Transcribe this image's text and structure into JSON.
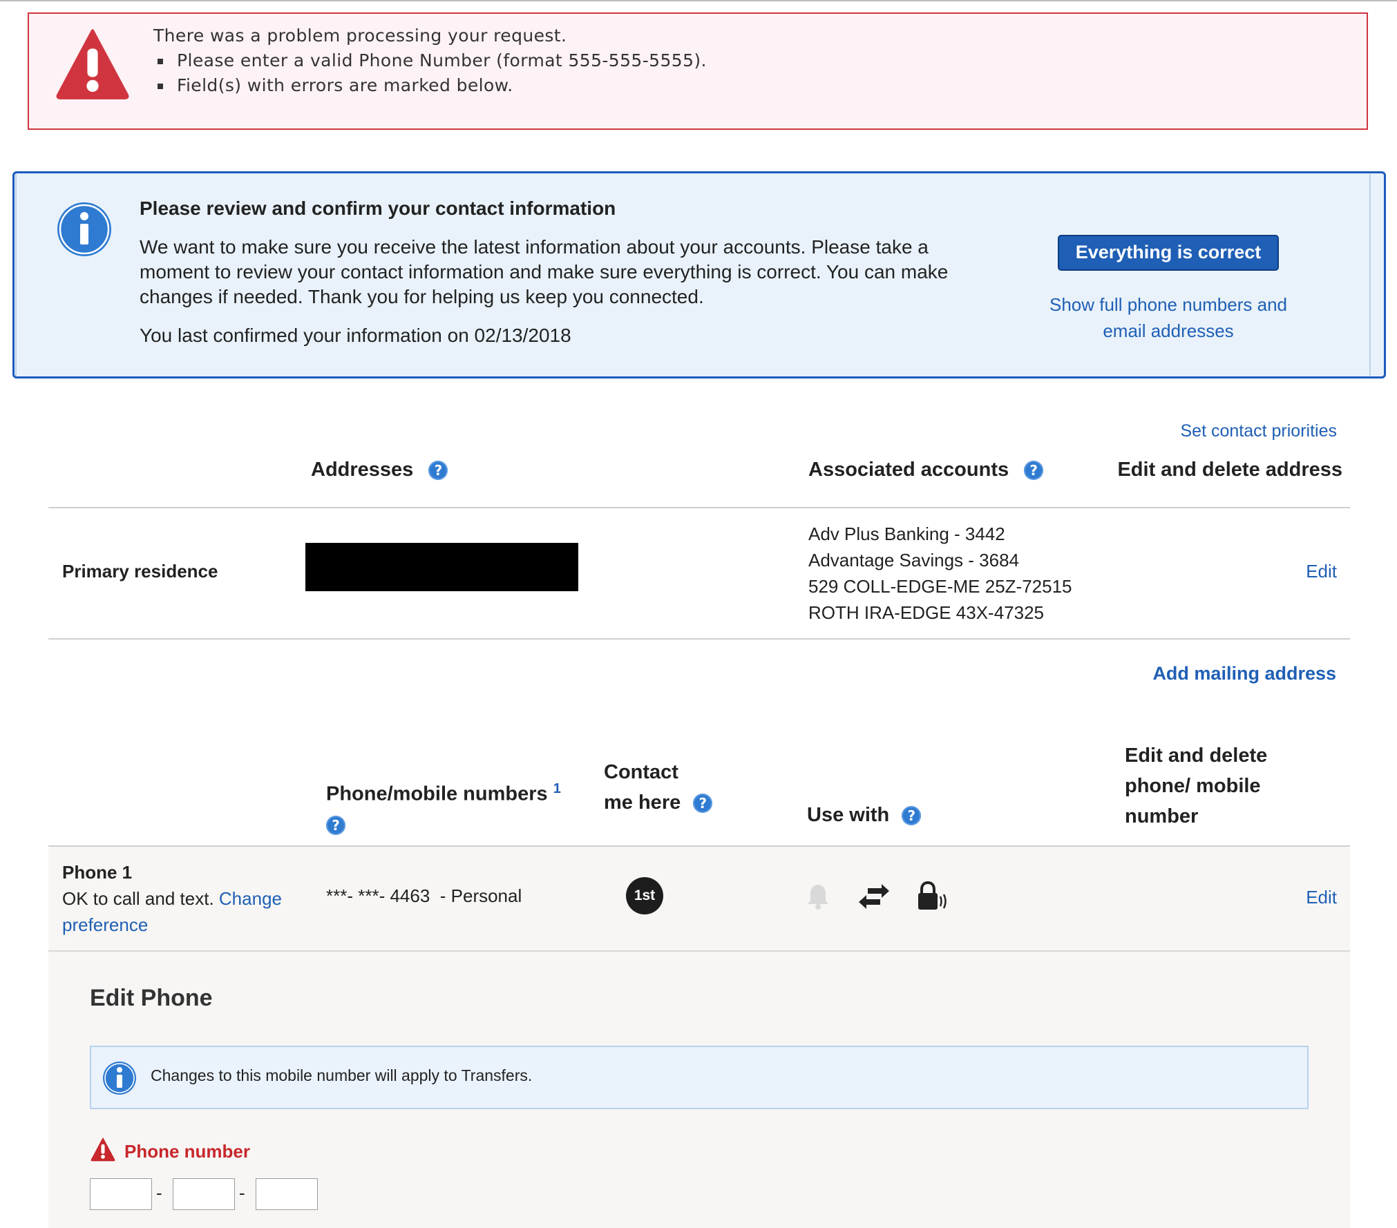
{
  "error": {
    "heading": "There was a problem processing your request.",
    "items": [
      "Please enter a valid Phone Number (format 555-555-5555).",
      "Field(s) with errors are marked below."
    ]
  },
  "review": {
    "title": "Please review and confirm your contact information",
    "body": "We want to make sure you receive the latest information about your accounts. Please take a moment to review your contact information and make sure everything is correct. You can make changes if needed. Thank you for helping us keep you connected.",
    "last_confirmed": "You last confirmed your information on 02/13/2018",
    "confirm_button": "Everything is correct",
    "show_full_link_line1": "Show full phone numbers and",
    "show_full_link_line2": "email addresses"
  },
  "addresses": {
    "set_priorities": "Set contact priorities",
    "col_addresses": "Addresses",
    "col_accounts": "Associated accounts",
    "col_edit": "Edit and delete address",
    "row_label": "Primary residence",
    "accounts": [
      "Adv Plus Banking - 3442",
      "Advantage Savings - 3684",
      "529 COLL-EDGE-ME 25Z-72515",
      "ROTH IRA-EDGE 43X-47325"
    ],
    "edit": "Edit",
    "add_mailing": "Add mailing address"
  },
  "phones": {
    "col_numbers": "Phone/mobile numbers",
    "col_numbers_sup": "1",
    "col_contact_line1": "Contact",
    "col_contact_line2": "me here",
    "col_use_with": "Use with",
    "col_edit_line1": "Edit and delete",
    "col_edit_line2": "phone/ mobile",
    "col_edit_line3": "number",
    "row_label": "Phone 1",
    "ok_text": "OK to call and text.",
    "change_link_1": "Change",
    "change_link_2": "preference",
    "number": "***- ***- 4463  - Personal",
    "badge": "1st",
    "use_with_icons": [
      "bell-icon",
      "transfer-arrows-icon",
      "lock-sound-icon"
    ],
    "edit": "Edit"
  },
  "edit_phone": {
    "title": "Edit Phone",
    "notice": "Changes to this mobile number will apply to Transfers.",
    "field_label": "Phone number",
    "separator": "-"
  },
  "colors": {
    "error_red": "#d0353f",
    "link_blue": "#1f5fb5",
    "help_blue": "#2f7bd1",
    "info_bg": "#e9f2fa"
  }
}
